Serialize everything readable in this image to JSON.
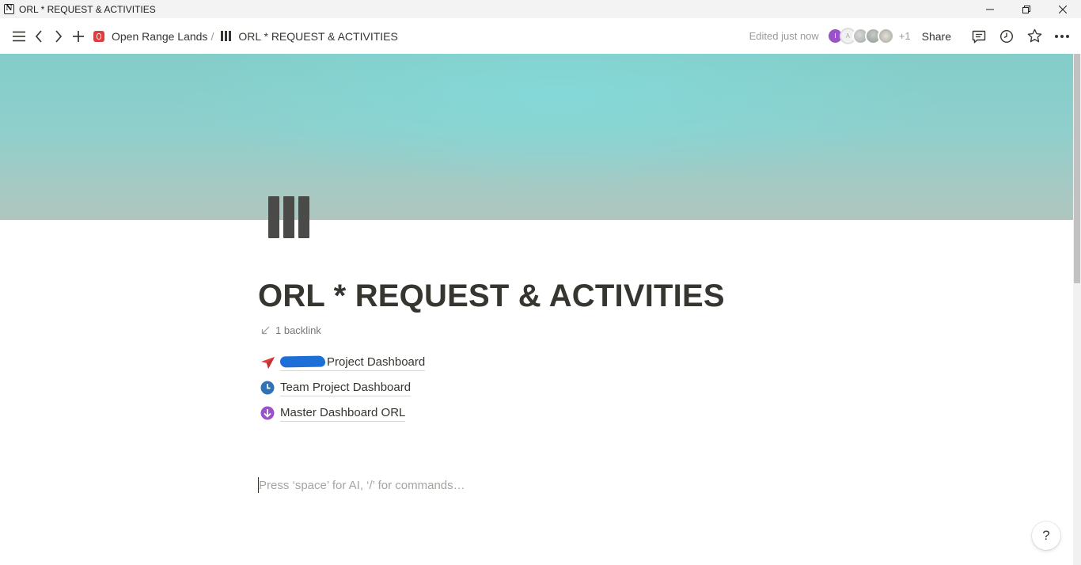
{
  "window": {
    "title": "ORL * REQUEST & ACTIVITIES",
    "app_logo_letter": "N"
  },
  "breadcrumb": {
    "workspace": "Open Range Lands",
    "separator": "/",
    "page": "ORL * REQUEST & ACTIVITIES"
  },
  "topbar": {
    "edited_status": "Edited just now",
    "avatars": [
      "I",
      "A",
      "",
      "",
      ""
    ],
    "extra_count": "+1",
    "share_label": "Share"
  },
  "page": {
    "title": "ORL * REQUEST & ACTIVITIES",
    "backlink": "1 backlink",
    "links": [
      {
        "label": "Project Dashboard",
        "icon": "paper-plane-icon",
        "color": "#e03e3e",
        "redacted_prefix": true
      },
      {
        "label": "Team Project Dashboard",
        "icon": "clock-icon",
        "color": "#2f73b6"
      },
      {
        "label": "Master Dashboard ORL",
        "icon": "arrow-down-circle-icon",
        "color": "#9a52c9"
      }
    ],
    "placeholder": "Press ‘space’ for AI, ‘/’ for commands…"
  },
  "help_label": "?",
  "colors": {
    "workspace_icon": "#e03e3e",
    "redaction": "#1b6fd6",
    "text": "#37352f",
    "muted": "#9b9a97"
  }
}
